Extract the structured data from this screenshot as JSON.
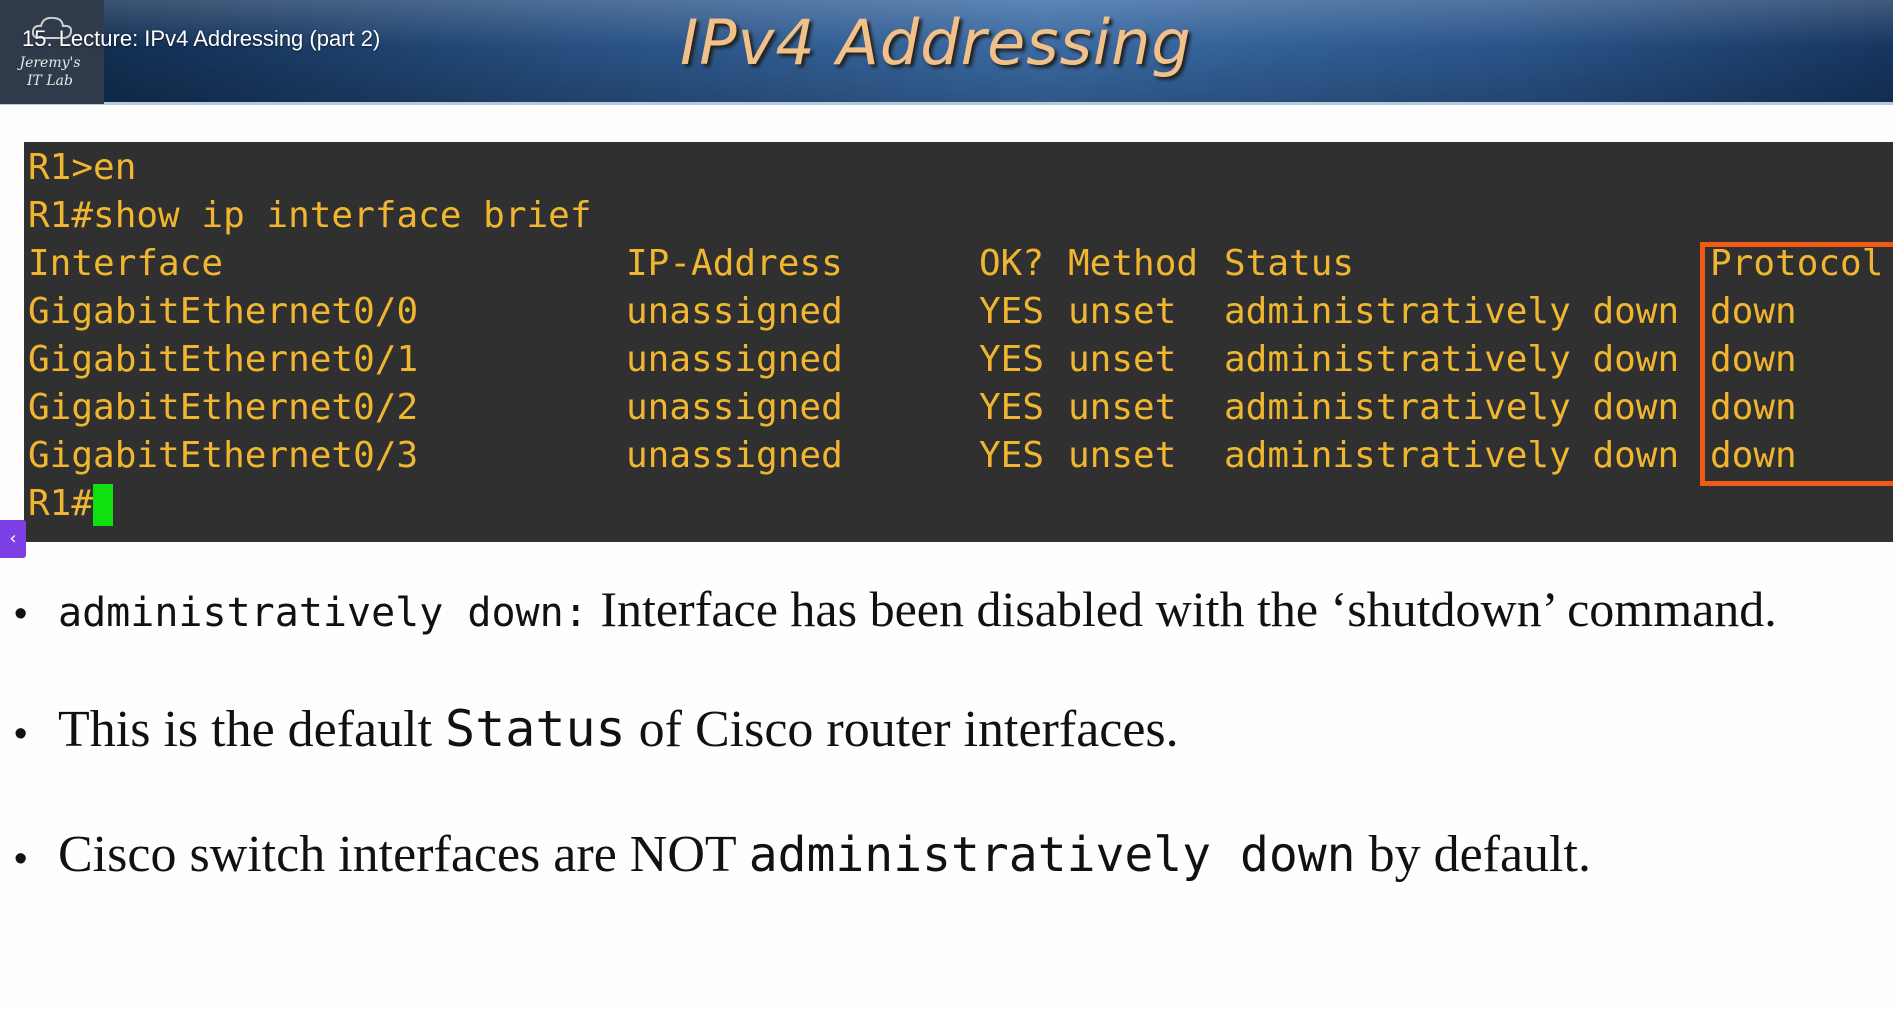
{
  "header": {
    "lecture_title": "15. Lecture: IPv4 Addressing (part 2)",
    "slide_title": "IPv4 Addressing",
    "logo_text_line1": "Jeremy's",
    "logo_text_line2": "IT Lab"
  },
  "terminal": {
    "line1": "R1>en",
    "line2": "R1#show ip interface brief",
    "columns": {
      "interface": "Interface",
      "ip": "IP-Address",
      "ok": "OK?",
      "method": "Method",
      "status": "Status",
      "protocol": "Protocol"
    },
    "rows": [
      {
        "interface": "GigabitEthernet0/0",
        "ip": "unassigned",
        "ok": "YES",
        "method": "unset",
        "status": "administratively down",
        "protocol": "down"
      },
      {
        "interface": "GigabitEthernet0/1",
        "ip": "unassigned",
        "ok": "YES",
        "method": "unset",
        "status": "administratively down",
        "protocol": "down"
      },
      {
        "interface": "GigabitEthernet0/2",
        "ip": "unassigned",
        "ok": "YES",
        "method": "unset",
        "status": "administratively down",
        "protocol": "down"
      },
      {
        "interface": "GigabitEthernet0/3",
        "ip": "unassigned",
        "ok": "YES",
        "method": "unset",
        "status": "administratively down",
        "protocol": "down"
      }
    ],
    "prompt": "R1#",
    "text_color": "#f0b630",
    "cursor_color": "#10e010",
    "highlight_color": "#f05a14"
  },
  "bullets": [
    {
      "code": "administratively down:",
      "text": " Interface has been disabled with the ‘shutdown’ command."
    },
    {
      "text_before": "This is the default ",
      "code": "Status",
      "text_after": " of Cisco router interfaces."
    },
    {
      "text_before": "Cisco switch interfaces are NOT ",
      "code": "administratively down",
      "text_after": " by default."
    }
  ],
  "side_tab_icon": "chevron-left-icon"
}
